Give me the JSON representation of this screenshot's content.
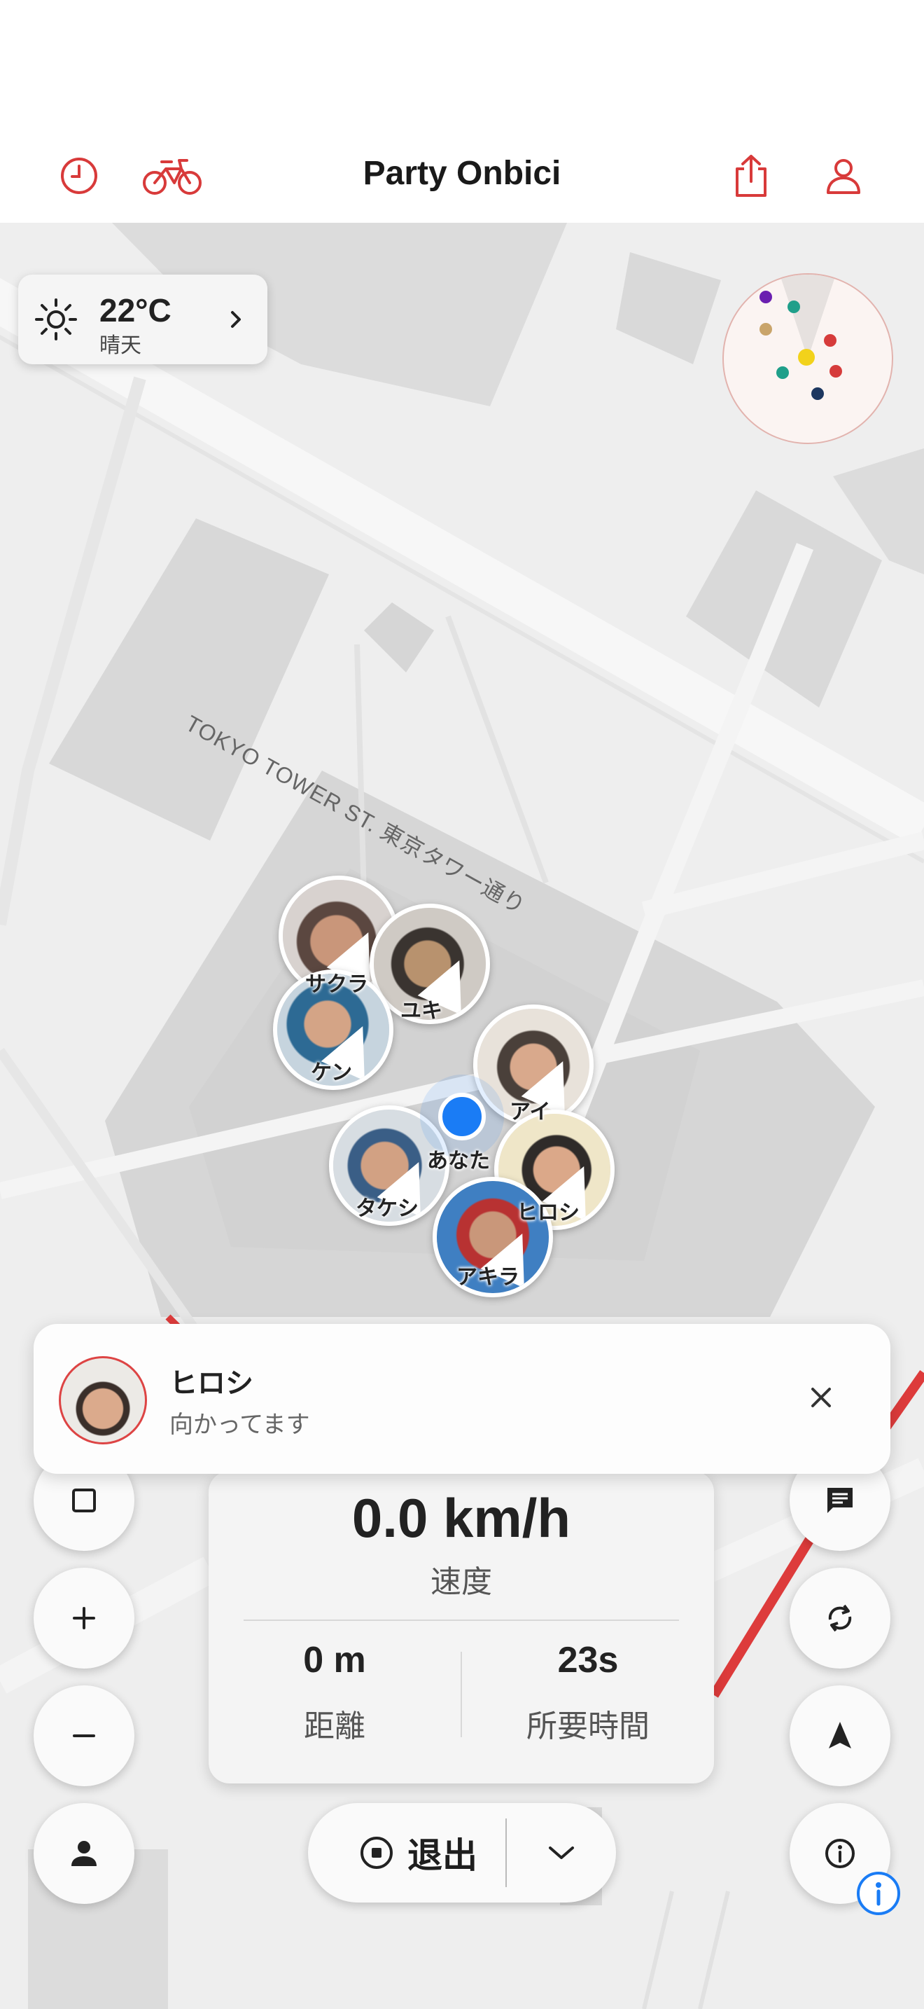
{
  "header": {
    "title": "Party Onbici",
    "left_icons": [
      "clock-icon",
      "bike-icon"
    ],
    "right_icons": [
      "share-icon",
      "profile-icon"
    ],
    "accent_color": "#d83a3a"
  },
  "weather": {
    "temperature": "22°C",
    "condition": "晴天",
    "icon": "sun-icon"
  },
  "map": {
    "street_label": "TOKYO TOWER ST. 東京タワー通り",
    "riders": [
      {
        "name": "サクラ"
      },
      {
        "name": "ユキ"
      },
      {
        "name": "ケン"
      },
      {
        "name": "アイ"
      },
      {
        "name": "タケシ"
      },
      {
        "name": "ヒロシ"
      },
      {
        "name": "アキラ"
      }
    ],
    "self_label": "あなた"
  },
  "notification": {
    "name": "ヒロシ",
    "message": "向かってます"
  },
  "stats": {
    "speed": "0.0 km/h",
    "speed_label": "速度",
    "distance": "0 m",
    "distance_label": "距離",
    "duration": "23s",
    "duration_label": "所要時間"
  },
  "controls": {
    "exit_label": "退出",
    "left_buttons": [
      "stop-icon",
      "zoom-in-icon",
      "zoom-out-icon",
      "person-icon"
    ],
    "right_buttons": [
      "chat-icon",
      "refresh-icon",
      "navigate-icon",
      "info-icon"
    ]
  }
}
